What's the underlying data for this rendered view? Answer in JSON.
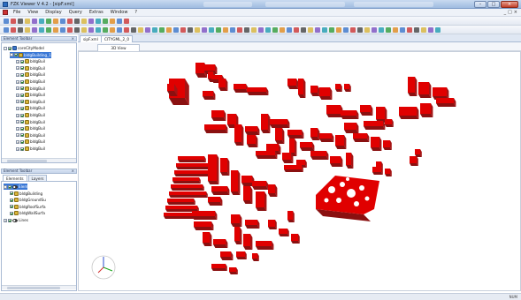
{
  "window": {
    "title": "FZK Viewer V 4.2 - [sipF.xml]",
    "controls": {
      "minimize": "–",
      "maximize": "□",
      "close": "×"
    }
  },
  "menu": {
    "items": [
      "File",
      "View",
      "Display",
      "Query",
      "Extras",
      "Window",
      "?"
    ],
    "mdi": [
      "_",
      "□",
      "×"
    ]
  },
  "toolbars": {
    "row1_icon_count": 18,
    "row2_icon_count": 62
  },
  "element_toolbar": {
    "title": "Element Toolbar",
    "close": "×",
    "tree": [
      {
        "label": "coreCityModel",
        "icon": "model-icon",
        "level": 0,
        "expander": "-",
        "checked": true,
        "selected": false
      },
      {
        "label": "bldgBuilding_1",
        "icon": "building-icon",
        "level": 1,
        "expander": "-",
        "checked": true,
        "selected": true
      },
      {
        "label": "bldgBuil",
        "icon": "building-icon",
        "level": 2,
        "expander": "+",
        "checked": true,
        "selected": false
      },
      {
        "label": "bldgBuil",
        "icon": "building-icon",
        "level": 2,
        "expander": "+",
        "checked": true,
        "selected": false
      },
      {
        "label": "bldgBuil",
        "icon": "building-icon",
        "level": 2,
        "expander": "+",
        "checked": true,
        "selected": false
      },
      {
        "label": "bldgBuil",
        "icon": "building-icon",
        "level": 2,
        "expander": "+",
        "checked": true,
        "selected": false
      },
      {
        "label": "bldgBuil",
        "icon": "building-icon",
        "level": 2,
        "expander": "+",
        "checked": true,
        "selected": false
      },
      {
        "label": "bldgBuil",
        "icon": "building-icon",
        "level": 2,
        "expander": "+",
        "checked": true,
        "selected": false
      },
      {
        "label": "bldgBuil",
        "icon": "building-icon",
        "level": 2,
        "expander": "+",
        "checked": true,
        "selected": false
      },
      {
        "label": "bldgBuil",
        "icon": "building-icon",
        "level": 2,
        "expander": "+",
        "checked": true,
        "selected": false
      },
      {
        "label": "bldgBuil",
        "icon": "building-icon",
        "level": 2,
        "expander": "+",
        "checked": true,
        "selected": false
      },
      {
        "label": "bldgBuil",
        "icon": "building-icon",
        "level": 2,
        "expander": "+",
        "checked": true,
        "selected": false
      },
      {
        "label": "bldgBuil",
        "icon": "building-icon",
        "level": 2,
        "expander": "+",
        "checked": true,
        "selected": false
      },
      {
        "label": "bldgBuil",
        "icon": "building-icon",
        "level": 2,
        "expander": "+",
        "checked": true,
        "selected": false
      },
      {
        "label": "bldgBuil",
        "icon": "building-icon",
        "level": 2,
        "expander": "+",
        "checked": true,
        "selected": false
      },
      {
        "label": "bldgBuil",
        "icon": "building-icon",
        "level": 2,
        "expander": "+",
        "checked": true,
        "selected": false
      }
    ]
  },
  "element_toolbar2": {
    "title": "Element Toolbar",
    "close": "×",
    "tabs": [
      "Elements",
      "Layers"
    ],
    "tree": [
      {
        "label": "Elem",
        "icon": "eye-icon",
        "level": 0,
        "expander": "-",
        "checked": true,
        "selected": true
      },
      {
        "label": "bldgBuilding",
        "icon": "building-icon",
        "level": 1,
        "expander": "",
        "checked": true,
        "selected": false
      },
      {
        "label": "bldgGroundSu",
        "icon": "building-icon",
        "level": 1,
        "expander": "",
        "checked": true,
        "selected": false
      },
      {
        "label": "bldgRoofSurfa",
        "icon": "building-icon",
        "level": 1,
        "expander": "",
        "checked": true,
        "selected": false
      },
      {
        "label": "bldgWallSurfa",
        "icon": "building-icon",
        "level": 1,
        "expander": "",
        "checked": true,
        "selected": false
      },
      {
        "label": "Lines",
        "icon": "eye-icon",
        "level": 0,
        "expander": "+",
        "checked": true,
        "selected": false
      }
    ]
  },
  "document": {
    "tabs": [
      "sipF.xml",
      "CITYGML_2_0"
    ],
    "view_tab": "3D View"
  },
  "status": {
    "right": "NUM"
  },
  "colors": {
    "building": "#e00000",
    "building_side": "#8a1010",
    "selection": "#3a78d6"
  }
}
